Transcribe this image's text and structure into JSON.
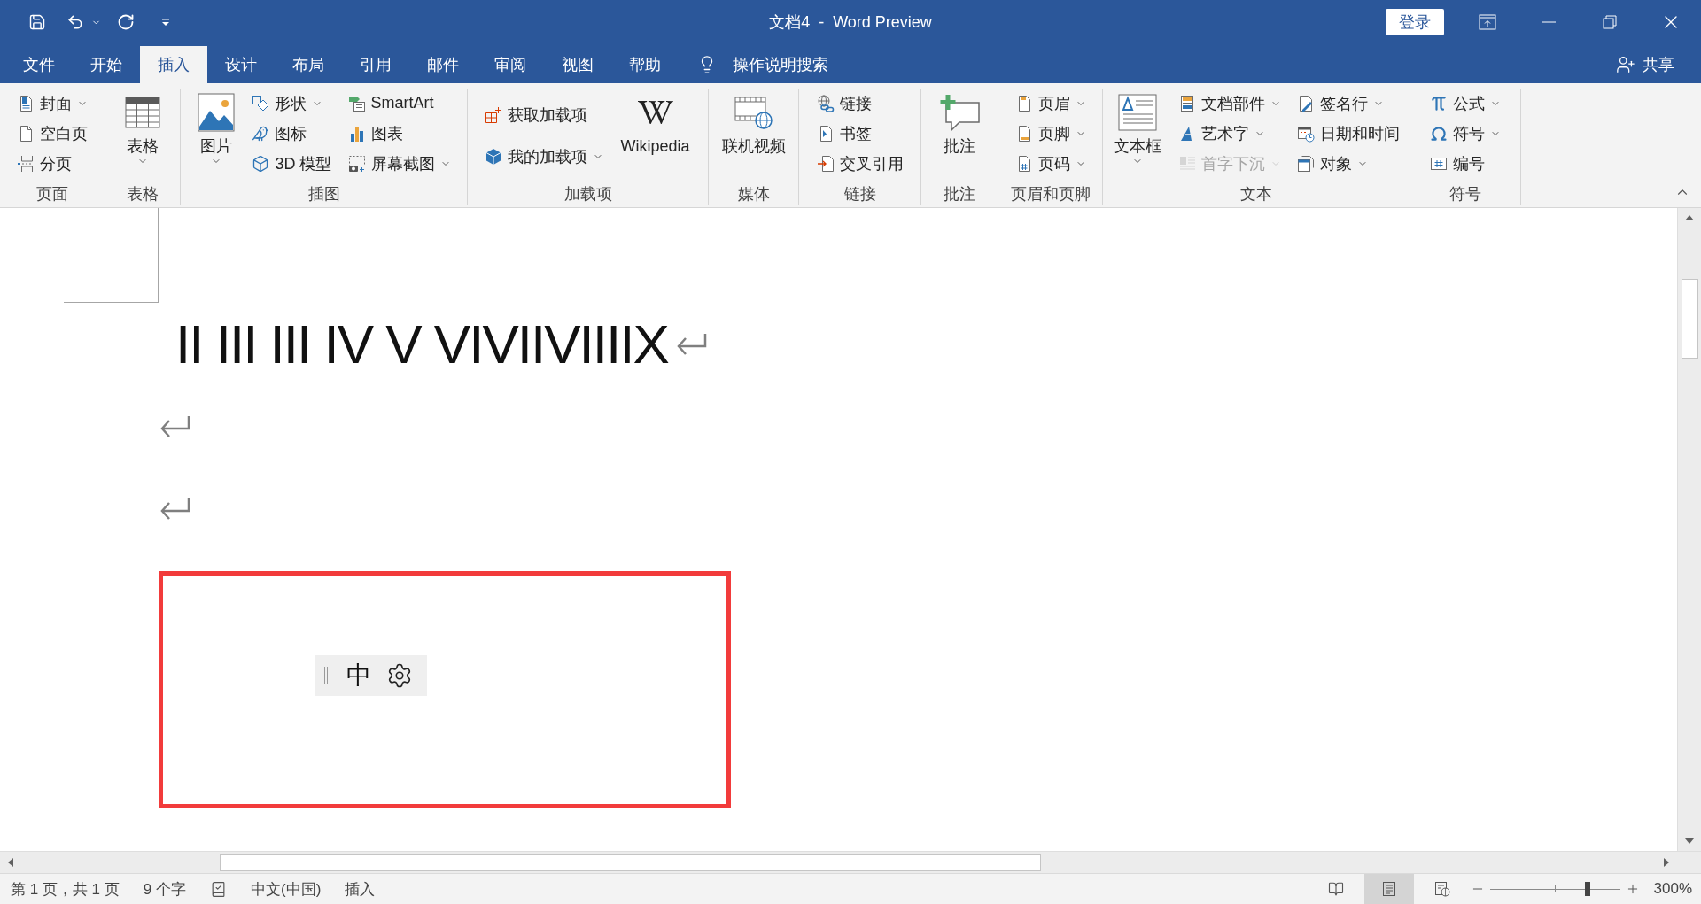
{
  "title_bar": {
    "title": "文档4  -  Word Preview",
    "sign_in": "登录"
  },
  "tabs": [
    {
      "label": "文件",
      "selected": false
    },
    {
      "label": "开始",
      "selected": false
    },
    {
      "label": "插入",
      "selected": true
    },
    {
      "label": "设计",
      "selected": false
    },
    {
      "label": "布局",
      "selected": false
    },
    {
      "label": "引用",
      "selected": false
    },
    {
      "label": "邮件",
      "selected": false
    },
    {
      "label": "审阅",
      "selected": false
    },
    {
      "label": "视图",
      "selected": false
    },
    {
      "label": "帮助",
      "selected": false
    }
  ],
  "tell_me": {
    "label": "操作说明搜索"
  },
  "share": {
    "label": "共享"
  },
  "ribbon": {
    "groups": [
      {
        "label": "页面",
        "columns": [
          [
            {
              "kind": "small",
              "label": "封面",
              "dropdown": true,
              "disabled": false
            },
            {
              "kind": "small",
              "label": "空白页",
              "dropdown": false,
              "disabled": false
            },
            {
              "kind": "small",
              "label": "分页",
              "dropdown": false,
              "disabled": false
            }
          ]
        ]
      },
      {
        "label": "表格",
        "columns": [
          [
            {
              "kind": "large",
              "label": "表格",
              "dropdown": true,
              "disabled": false
            }
          ]
        ]
      },
      {
        "label": "插图",
        "columns": [
          [
            {
              "kind": "large",
              "label": "图片",
              "dropdown": true,
              "disabled": false
            }
          ],
          [
            {
              "kind": "small",
              "label": "形状",
              "dropdown": true,
              "disabled": false
            },
            {
              "kind": "small",
              "label": "图标",
              "dropdown": false,
              "disabled": false
            },
            {
              "kind": "small",
              "label": "3D 模型",
              "dropdown": false,
              "disabled": false
            }
          ],
          [
            {
              "kind": "small",
              "label": "SmartArt",
              "dropdown": false,
              "disabled": false
            },
            {
              "kind": "small",
              "label": "图表",
              "dropdown": false,
              "disabled": false
            },
            {
              "kind": "small",
              "label": "屏幕截图",
              "dropdown": true,
              "disabled": false
            }
          ]
        ]
      },
      {
        "label": "加载项",
        "columns": [
          [
            {
              "kind": "small",
              "label": "获取加载项",
              "dropdown": false,
              "disabled": false
            },
            {
              "kind": "small",
              "label": "我的加载项",
              "dropdown": true,
              "disabled": false
            }
          ],
          [
            {
              "kind": "large",
              "label": "Wikipedia",
              "dropdown": false,
              "disabled": false
            }
          ]
        ]
      },
      {
        "label": "媒体",
        "columns": [
          [
            {
              "kind": "large",
              "label": "联机视频",
              "dropdown": false,
              "disabled": false
            }
          ]
        ]
      },
      {
        "label": "链接",
        "columns": [
          [
            {
              "kind": "small",
              "label": "链接",
              "dropdown": false,
              "disabled": false
            },
            {
              "kind": "small",
              "label": "书签",
              "dropdown": false,
              "disabled": false
            },
            {
              "kind": "small",
              "label": "交叉引用",
              "dropdown": false,
              "disabled": false
            }
          ]
        ]
      },
      {
        "label": "批注",
        "columns": [
          [
            {
              "kind": "large",
              "label": "批注",
              "dropdown": false,
              "disabled": false
            }
          ]
        ]
      },
      {
        "label": "页眉和页脚",
        "columns": [
          [
            {
              "kind": "small",
              "label": "页眉",
              "dropdown": true,
              "disabled": false
            },
            {
              "kind": "small",
              "label": "页脚",
              "dropdown": true,
              "disabled": false
            },
            {
              "kind": "small",
              "label": "页码",
              "dropdown": true,
              "disabled": false
            }
          ]
        ]
      },
      {
        "label": "文本",
        "columns": [
          [
            {
              "kind": "large",
              "label": "文本框",
              "dropdown": true,
              "disabled": false
            }
          ],
          [
            {
              "kind": "small",
              "label": "文档部件",
              "dropdown": true,
              "disabled": false
            },
            {
              "kind": "small",
              "label": "艺术字",
              "dropdown": true,
              "disabled": false
            },
            {
              "kind": "small",
              "label": "首字下沉",
              "dropdown": true,
              "disabled": true
            }
          ],
          [
            {
              "kind": "small",
              "label": "签名行",
              "dropdown": true,
              "disabled": false
            },
            {
              "kind": "small",
              "label": "日期和时间",
              "dropdown": false,
              "disabled": false
            },
            {
              "kind": "small",
              "label": "对象",
              "dropdown": true,
              "disabled": false
            }
          ]
        ]
      },
      {
        "label": "符号",
        "columns": [
          [
            {
              "kind": "small",
              "label": "公式",
              "dropdown": true,
              "disabled": false
            },
            {
              "kind": "small",
              "label": "符号",
              "dropdown": true,
              "disabled": false
            },
            {
              "kind": "small",
              "label": "编号",
              "dropdown": false,
              "disabled": false
            }
          ]
        ]
      }
    ]
  },
  "document": {
    "paragraphs": [
      {
        "kind": "text",
        "text": "II III III IV V VIVIIVIIIIX"
      },
      {
        "kind": "empty"
      },
      {
        "kind": "empty"
      }
    ],
    "ime_toolbar": {
      "mode": "中"
    }
  },
  "status_bar": {
    "page_info": "第 1 页，共 1 页",
    "word_count": "9 个字",
    "language": "中文(中国)",
    "input_mode": "插入",
    "views": [
      {
        "kind": "read",
        "selected": false
      },
      {
        "kind": "print",
        "selected": true
      },
      {
        "kind": "web",
        "selected": false
      }
    ],
    "zoom": {
      "level": 0.75,
      "reading": "300%"
    }
  }
}
